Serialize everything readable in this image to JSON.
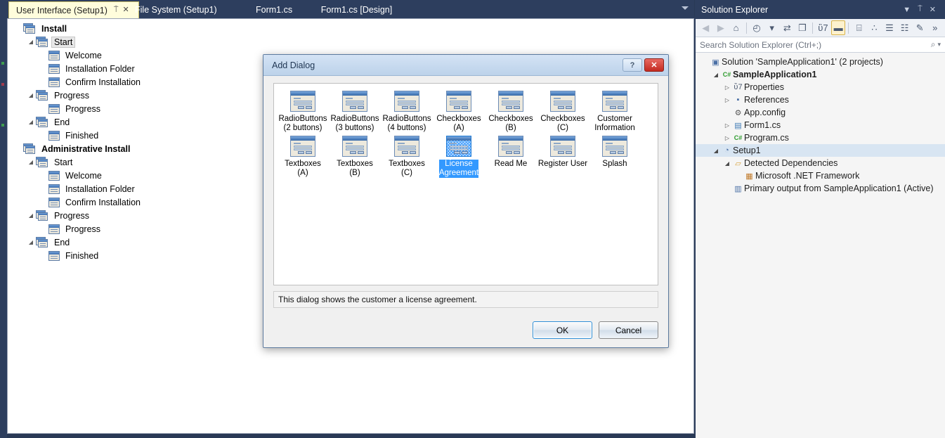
{
  "tabs": [
    {
      "label": "User Interface (Setup1)",
      "active": true,
      "pin": "⍑",
      "close": "✕"
    },
    {
      "label": "File System (Setup1)",
      "active": false
    },
    {
      "label": "Form1.cs",
      "active": false
    },
    {
      "label": "Form1.cs [Design]",
      "active": false
    }
  ],
  "designer_tree": [
    {
      "label": "Install",
      "depth": 0,
      "icon": "stack",
      "arrow": "",
      "bold": true,
      "selected": false
    },
    {
      "label": "Start",
      "depth": 1,
      "icon": "stack",
      "arrow": "◢",
      "bold": false,
      "selected": true
    },
    {
      "label": "Welcome",
      "depth": 2,
      "icon": "dialog",
      "arrow": "",
      "bold": false,
      "selected": false
    },
    {
      "label": "Installation Folder",
      "depth": 2,
      "icon": "dialog",
      "arrow": "",
      "bold": false,
      "selected": false
    },
    {
      "label": "Confirm Installation",
      "depth": 2,
      "icon": "dialog",
      "arrow": "",
      "bold": false,
      "selected": false
    },
    {
      "label": "Progress",
      "depth": 1,
      "icon": "stack",
      "arrow": "◢",
      "bold": false,
      "selected": false
    },
    {
      "label": "Progress",
      "depth": 2,
      "icon": "dialog",
      "arrow": "",
      "bold": false,
      "selected": false
    },
    {
      "label": "End",
      "depth": 1,
      "icon": "stack",
      "arrow": "◢",
      "bold": false,
      "selected": false
    },
    {
      "label": "Finished",
      "depth": 2,
      "icon": "dialog",
      "arrow": "",
      "bold": false,
      "selected": false
    },
    {
      "label": "Administrative Install",
      "depth": 0,
      "icon": "stack",
      "arrow": "",
      "bold": true,
      "selected": false
    },
    {
      "label": "Start",
      "depth": 1,
      "icon": "stack",
      "arrow": "◢",
      "bold": false,
      "selected": false
    },
    {
      "label": "Welcome",
      "depth": 2,
      "icon": "dialog",
      "arrow": "",
      "bold": false,
      "selected": false
    },
    {
      "label": "Installation Folder",
      "depth": 2,
      "icon": "dialog",
      "arrow": "",
      "bold": false,
      "selected": false
    },
    {
      "label": "Confirm Installation",
      "depth": 2,
      "icon": "dialog",
      "arrow": "",
      "bold": false,
      "selected": false
    },
    {
      "label": "Progress",
      "depth": 1,
      "icon": "stack",
      "arrow": "◢",
      "bold": false,
      "selected": false
    },
    {
      "label": "Progress",
      "depth": 2,
      "icon": "dialog",
      "arrow": "",
      "bold": false,
      "selected": false
    },
    {
      "label": "End",
      "depth": 1,
      "icon": "stack",
      "arrow": "◢",
      "bold": false,
      "selected": false
    },
    {
      "label": "Finished",
      "depth": 2,
      "icon": "dialog",
      "arrow": "",
      "bold": false,
      "selected": false
    }
  ],
  "dialog": {
    "title": "Add Dialog",
    "help_label": "?",
    "close_label": "✕",
    "description": "This dialog shows the customer a license agreement.",
    "ok_label": "OK",
    "cancel_label": "Cancel",
    "rows": [
      [
        {
          "caption": "RadioButtons\n(2 buttons)",
          "selected": false
        },
        {
          "caption": "RadioButtons\n(3 buttons)",
          "selected": false
        },
        {
          "caption": "RadioButtons\n(4 buttons)",
          "selected": false
        },
        {
          "caption": "Checkboxes\n(A)",
          "selected": false
        },
        {
          "caption": "Checkboxes\n(B)",
          "selected": false
        },
        {
          "caption": "Checkboxes\n(C)",
          "selected": false
        },
        {
          "caption": "Customer\nInformation",
          "selected": false
        }
      ],
      [
        {
          "caption": "Textboxes\n(A)",
          "selected": false
        },
        {
          "caption": "Textboxes\n(B)",
          "selected": false
        },
        {
          "caption": "Textboxes\n(C)",
          "selected": false
        },
        {
          "caption": "License\nAgreement",
          "selected": true
        },
        {
          "caption": "Read Me",
          "selected": false
        },
        {
          "caption": "Register User",
          "selected": false
        },
        {
          "caption": "Splash",
          "selected": false
        }
      ]
    ]
  },
  "solution_explorer": {
    "title": "Solution Explorer",
    "header_icons": {
      "dropdown": "▼",
      "pin": "⍑",
      "close": "✕"
    },
    "toolbar": [
      {
        "name": "back",
        "glyph": "◀",
        "state": "disabled"
      },
      {
        "name": "forward",
        "glyph": "▶",
        "state": "disabled"
      },
      {
        "name": "home",
        "glyph": "⌂",
        "state": "normal"
      },
      {
        "name": "separator",
        "glyph": "",
        "state": "sep"
      },
      {
        "name": "pending-changes",
        "glyph": "◴",
        "state": "normal"
      },
      {
        "name": "chevron-down",
        "glyph": "▾",
        "state": "normal"
      },
      {
        "name": "sync-views",
        "glyph": "⇄",
        "state": "normal"
      },
      {
        "name": "refresh",
        "glyph": "❐",
        "state": "normal"
      },
      {
        "name": "separator",
        "glyph": "",
        "state": "sep"
      },
      {
        "name": "properties",
        "glyph": "ὒ7",
        "state": "normal"
      },
      {
        "name": "preview-selected-items",
        "glyph": "▬",
        "state": "on"
      },
      {
        "name": "separator",
        "glyph": "",
        "state": "sep"
      },
      {
        "name": "show-all-files",
        "glyph": "⌸",
        "state": "normal"
      },
      {
        "name": "collapse-all",
        "glyph": "∴",
        "state": "normal"
      },
      {
        "name": "view-code",
        "glyph": "☰",
        "state": "normal"
      },
      {
        "name": "view-designer",
        "glyph": "☷",
        "state": "normal"
      },
      {
        "name": "edit",
        "glyph": "✎",
        "state": "normal"
      },
      {
        "name": "overflow",
        "glyph": "»",
        "state": "normal"
      }
    ],
    "search_placeholder": "Search Solution Explorer (Ctrl+;)",
    "search_icon": "⌕",
    "search_dropdown": "▾",
    "tree": [
      {
        "label": "Solution 'SampleApplication1' (2 projects)",
        "depth": 0,
        "arrow": "",
        "icon": "▣",
        "icon_color": "#4a6fa5",
        "bold": false,
        "selected": false
      },
      {
        "label": "SampleApplication1",
        "depth": 1,
        "arrow": "◢",
        "icon": "C#",
        "icon_color": "#2d9b2d",
        "bold": true,
        "selected": false
      },
      {
        "label": "Properties",
        "depth": 2,
        "arrow": "▷",
        "icon": "ὒ7",
        "icon_color": "#4c5a70",
        "bold": false,
        "selected": false
      },
      {
        "label": "References",
        "depth": 2,
        "arrow": "▷",
        "icon": "▪",
        "icon_color": "#4a6fa5",
        "bold": false,
        "selected": false
      },
      {
        "label": "App.config",
        "depth": 2,
        "arrow": "",
        "icon": "⚙",
        "icon_color": "#5a5a5a",
        "bold": false,
        "selected": false
      },
      {
        "label": "Form1.cs",
        "depth": 2,
        "arrow": "▷",
        "icon": "▤",
        "icon_color": "#3d7ab5",
        "bold": false,
        "selected": false
      },
      {
        "label": "Program.cs",
        "depth": 2,
        "arrow": "▷",
        "icon": "C#",
        "icon_color": "#2d9b2d",
        "bold": false,
        "selected": false
      },
      {
        "label": "Setup1",
        "depth": 1,
        "arrow": "◢",
        "icon": "◔",
        "icon_color": "#4a6fa5",
        "bold": false,
        "selected": true
      },
      {
        "label": "Detected Dependencies",
        "depth": 2,
        "arrow": "◢",
        "icon": "▱",
        "icon_color": "#d8a13a",
        "bold": false,
        "selected": false
      },
      {
        "label": "Microsoft .NET Framework",
        "depth": 3,
        "arrow": "",
        "icon": "▦",
        "icon_color": "#c07a2a",
        "bold": false,
        "selected": false
      },
      {
        "label": "Primary output from SampleApplication1 (Active)",
        "depth": 2,
        "arrow": "",
        "icon": "▥",
        "icon_color": "#4a6fa5",
        "bold": false,
        "selected": false
      }
    ]
  },
  "colors": {
    "chrome": "#2d3e5e",
    "active_tab": "#fffddc",
    "selection": "#3399ff",
    "se_selection": "#d8e5f2"
  }
}
